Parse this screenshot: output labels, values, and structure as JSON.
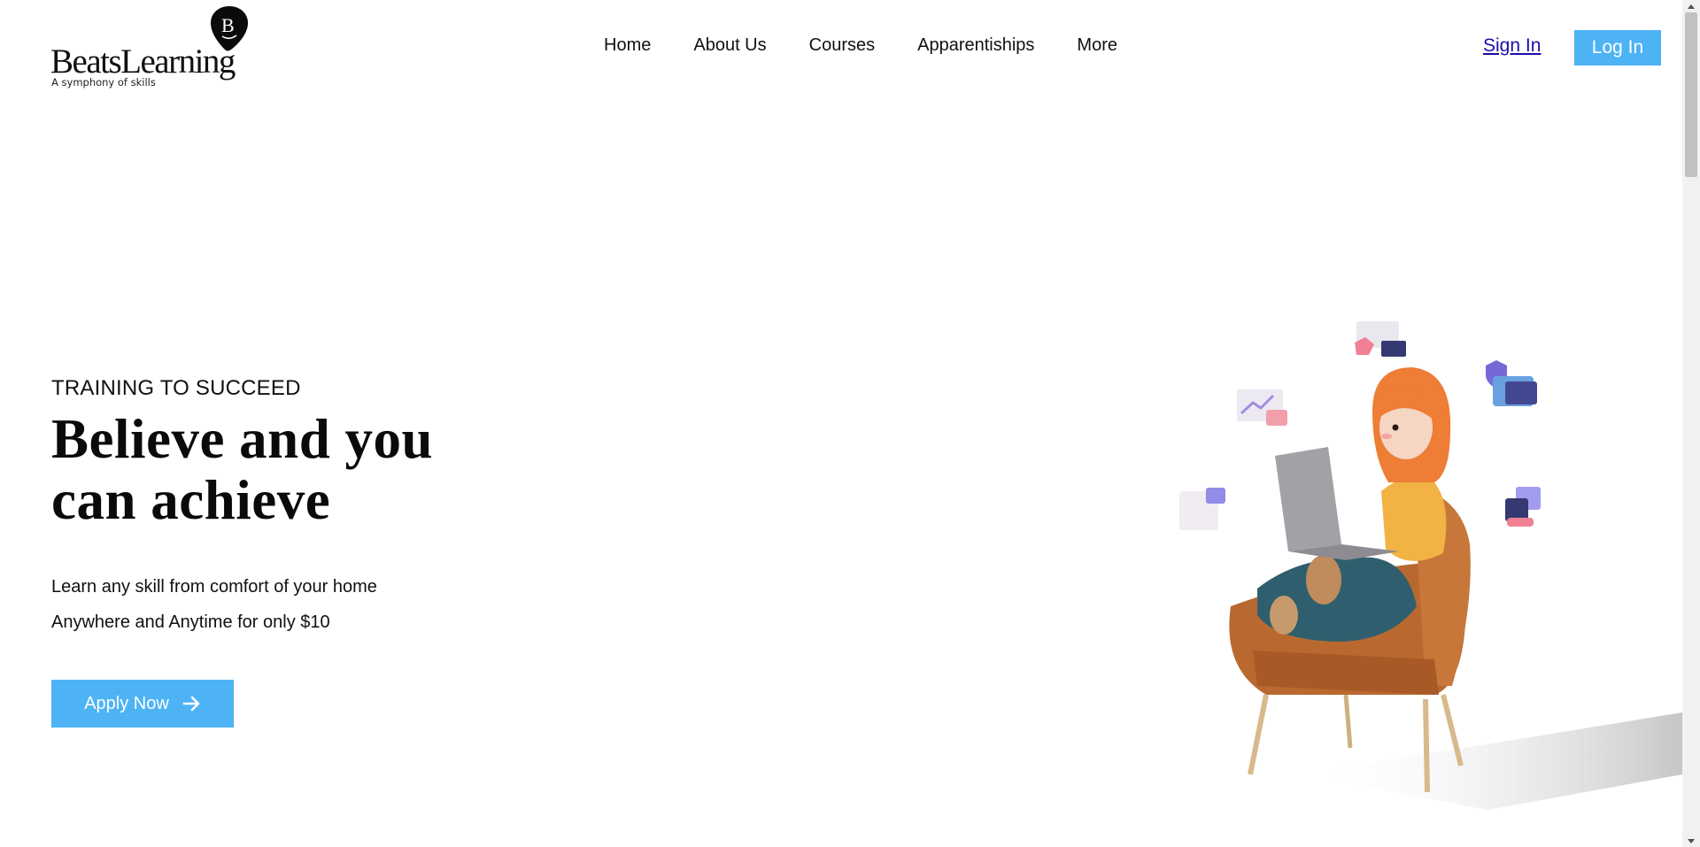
{
  "brand": {
    "name": "BeatsLearning",
    "tagline": "A symphony of skills",
    "monogram": "B",
    "logo_icon": "guitar-pick-logo-icon"
  },
  "nav": {
    "items": [
      {
        "label": "Home"
      },
      {
        "label": "About Us"
      },
      {
        "label": "Courses"
      },
      {
        "label": "Apparentiships"
      },
      {
        "label": "More"
      }
    ],
    "sign_in": "Sign In",
    "log_in": "Log In"
  },
  "hero": {
    "eyebrow": "TRAINING TO SUCCEED",
    "headline": "Believe and you can achieve",
    "line1": "Learn any skill from comfort of your home",
    "line2": "Anywhere and Anytime for only $10",
    "cta": "Apply Now",
    "cta_icon": "arrow-right-icon",
    "illustration": "girl-with-laptop-in-armchair-illustration"
  },
  "colors": {
    "accent": "#4db3f5",
    "link": "#1a0dab",
    "text": "#111111"
  }
}
